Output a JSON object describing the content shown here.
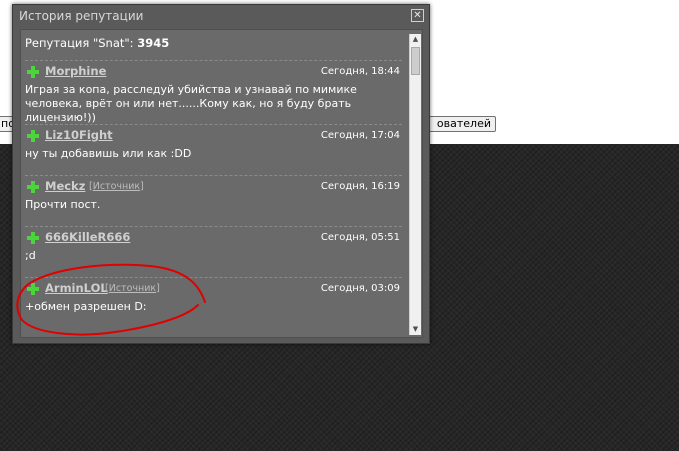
{
  "background": {
    "button_left_label": "по",
    "button_right_label": "ователей"
  },
  "modal": {
    "title": "История репутации",
    "close_symbol": "✕",
    "reputation_label": "Репутация \"Snat\":",
    "reputation_value": "3945",
    "entries": [
      {
        "user": "Morphine",
        "source": "",
        "time": "Сегодня, 18:44",
        "text": "Играя за копа, расследуй убийства и узнавай по мимике человека, врёт он или нет......Кому как, но я буду брать лицензию!))"
      },
      {
        "user": "Liz10Fight",
        "source": "",
        "time": "Сегодня, 17:04",
        "text": "ну ты добавишь или как :DD"
      },
      {
        "user": "Meckz",
        "source": "Источник",
        "time": "Сегодня, 16:19",
        "text": "Прочти пост."
      },
      {
        "user": "666KilleR666",
        "source": "",
        "time": "Сегодня, 05:51",
        "text": ";d"
      },
      {
        "user": "ArminLOL",
        "source": "Источник",
        "time": "Сегодня, 03:09",
        "text": "+обмен разрешен D:"
      }
    ]
  },
  "colors": {
    "plus_icon": "#4bd43b",
    "annotation_circle": "#e00000"
  }
}
